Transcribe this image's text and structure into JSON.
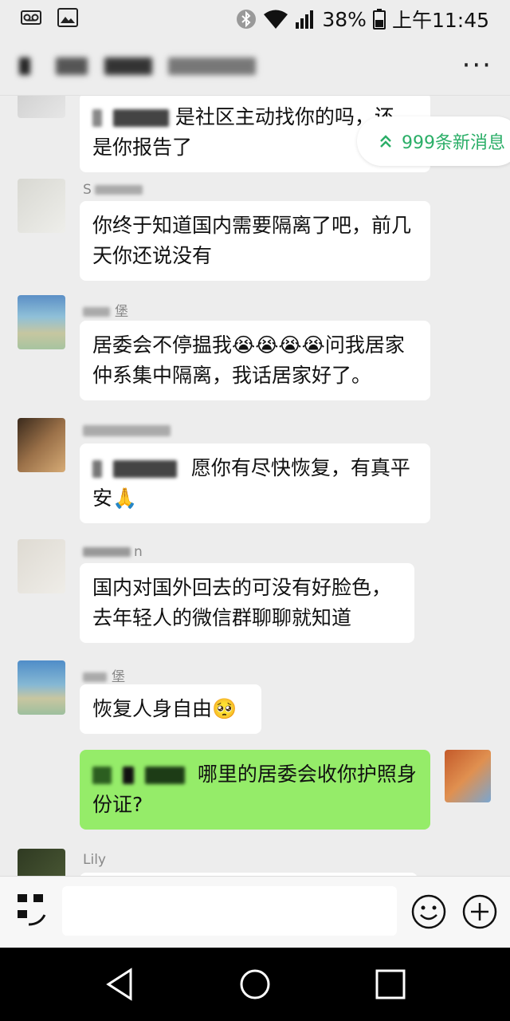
{
  "status": {
    "battery_percent": "38%",
    "time": "上午11:45"
  },
  "header": {
    "more_label": "···"
  },
  "new_messages": {
    "label": "999条新消息"
  },
  "messages": [
    {
      "text_line1": "是社区主动找你的吗，还",
      "text_line2": "是你报告了"
    },
    {
      "sender": "S",
      "text": "你终于知道国内需要隔离了吧，前几天你还说没有"
    },
    {
      "sender": "堡",
      "text": "居委会不停揾我😭😭😭😭问我居家仲系集中隔离，我话居家好了。"
    },
    {
      "text_line1": "愿你有尽快恢复，有真平",
      "text_line2": "安🙏"
    },
    {
      "sender": "n",
      "text": "国内对国外回去的可没有好脸色，去年轻人的微信群聊聊就知道"
    },
    {
      "sender": "堡",
      "text": "恢复人身自由🥺"
    },
    {
      "text_line1": "哪里的居委会收你护照身",
      "text_line2": "份证?"
    },
    {
      "sender": "Lily"
    }
  ]
}
